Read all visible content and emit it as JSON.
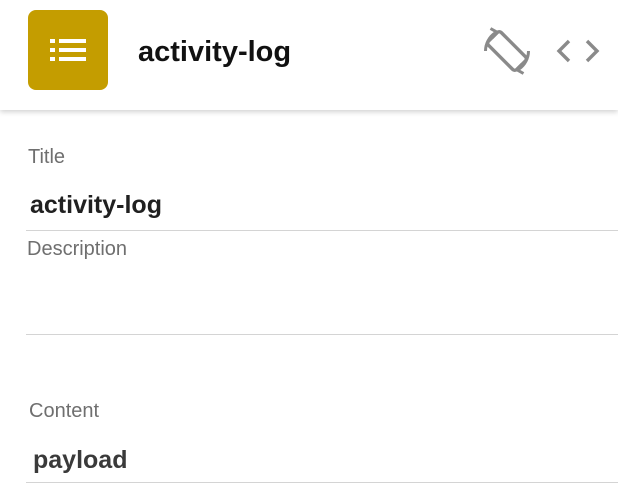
{
  "header": {
    "app_icon": "list-icon",
    "accent_color": "#c49d00",
    "title": "activity-log",
    "rotate_icon": "screen-rotation-icon",
    "code_icon": "code-icon"
  },
  "fields": {
    "title": {
      "label": "Title",
      "value": "activity-log"
    },
    "description": {
      "label": "Description",
      "value": ""
    },
    "content": {
      "label": "Content",
      "value": "payload"
    }
  }
}
